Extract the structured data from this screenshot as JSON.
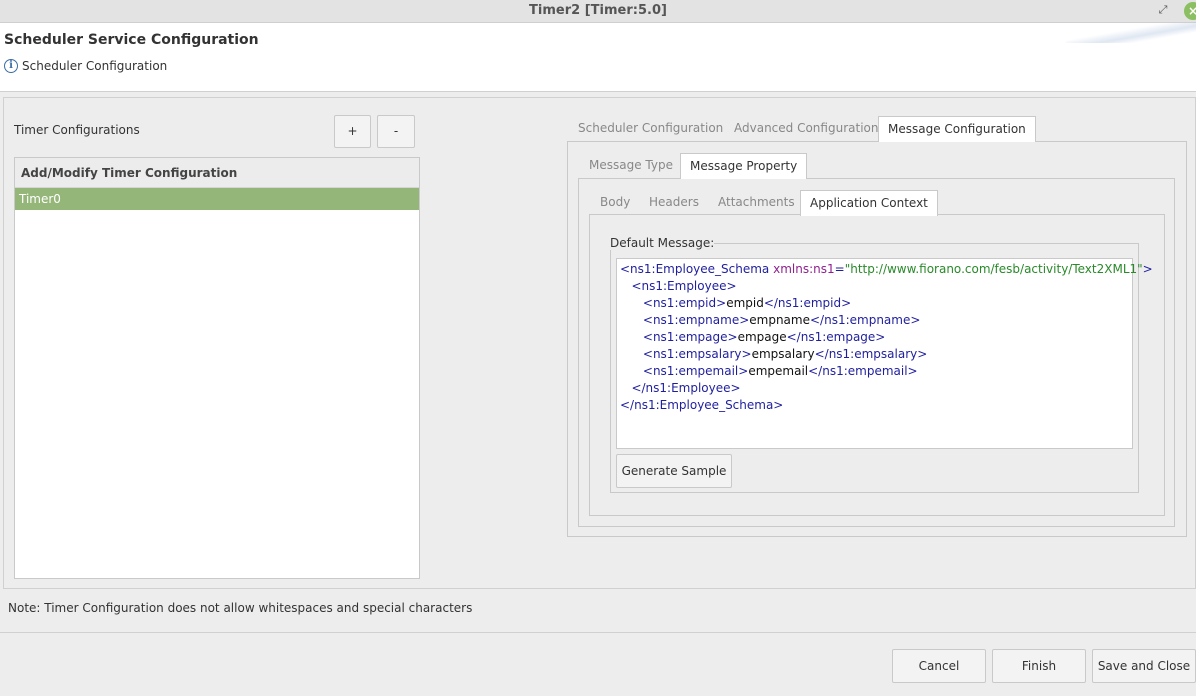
{
  "window": {
    "title": "Timer2 [Timer:5.0]"
  },
  "header": {
    "title": "Scheduler Service Configuration",
    "subtitle": "Scheduler Configuration"
  },
  "left": {
    "label": "Timer Configurations",
    "add_label": "+",
    "remove_label": "-",
    "list_header": "Add/Modify Timer Configuration",
    "items": [
      "Timer0"
    ]
  },
  "tabs_level1": [
    "Scheduler Configuration",
    "Advanced Configuration",
    "Message Configuration"
  ],
  "tabs_level2": [
    "Message Type",
    "Message Property"
  ],
  "tabs_level3": [
    "Body",
    "Headers",
    "Attachments",
    "Application Context"
  ],
  "default_message": {
    "label": "Default Message:",
    "root_open": "<ns1:Employee_Schema",
    "xmlns_attr": "xmlns:ns1",
    "xmlns_value": "\"http://www.fiorano.com/fesb/activity/Text2XML1\"",
    "root_open_end": ">",
    "employee_open": "<ns1:Employee>",
    "fields": [
      {
        "open": "<ns1:empid>",
        "value": "empid",
        "close": "</ns1:empid>"
      },
      {
        "open": "<ns1:empname>",
        "value": "empname",
        "close": "</ns1:empname>"
      },
      {
        "open": "<ns1:empage>",
        "value": "empage",
        "close": "</ns1:empage>"
      },
      {
        "open": "<ns1:empsalary>",
        "value": "empsalary",
        "close": "</ns1:empsalary>"
      },
      {
        "open": "<ns1:empemail>",
        "value": "empemail",
        "close": "</ns1:empemail>"
      }
    ],
    "employee_close": "</ns1:Employee>",
    "root_close": "</ns1:Employee_Schema>",
    "generate_label": "Generate Sample"
  },
  "note": "Note: Timer Configuration does not allow whitespaces and special characters",
  "footer": {
    "cancel": "Cancel",
    "finish": "Finish",
    "save_close": "Save and Close"
  },
  "colors": {
    "selected_row": "#95b679",
    "xml_tag": "#1f1f9e",
    "xml_attr_name": "#8f1f8f",
    "xml_attr_value": "#2a8a2a"
  }
}
